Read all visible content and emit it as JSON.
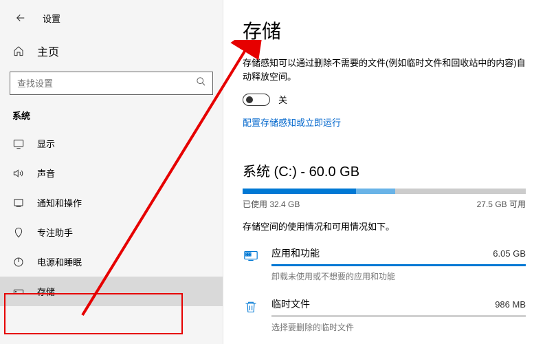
{
  "app_title": "设置",
  "home_label": "主页",
  "search": {
    "placeholder": "查找设置"
  },
  "section_label": "系统",
  "nav": {
    "items": [
      {
        "label": "显示"
      },
      {
        "label": "声音"
      },
      {
        "label": "通知和操作"
      },
      {
        "label": "专注助手"
      },
      {
        "label": "电源和睡眠"
      },
      {
        "label": "存储"
      }
    ]
  },
  "page": {
    "title": "存储",
    "sense_desc": "存储感知可以通过删除不需要的文件(例如临时文件和回收站中的内容)自动释放空间。",
    "toggle_label": "关",
    "config_link": "配置存储感知或立即运行",
    "drive_title": "系统 (C:) - 60.0 GB",
    "used_text": "已使用 32.4 GB",
    "free_text": "27.5 GB 可用",
    "usage_desc": "存储空间的使用情况和可用情况如下。",
    "categories": [
      {
        "name": "应用和功能",
        "size": "6.05 GB",
        "sub": "卸载未使用或不想要的应用和功能"
      },
      {
        "name": "临时文件",
        "size": "986 MB",
        "sub": "选择要删除的临时文件"
      }
    ]
  },
  "chart_data": {
    "type": "bar",
    "title": "系统 (C:) - 60.0 GB",
    "total_gb": 60.0,
    "used_gb": 32.4,
    "free_gb": 27.5,
    "used_pct": 54,
    "segments": [
      {
        "name": "应用和功能",
        "size_gb": 6.05
      },
      {
        "name": "临时文件",
        "size_gb": 0.986
      }
    ]
  }
}
